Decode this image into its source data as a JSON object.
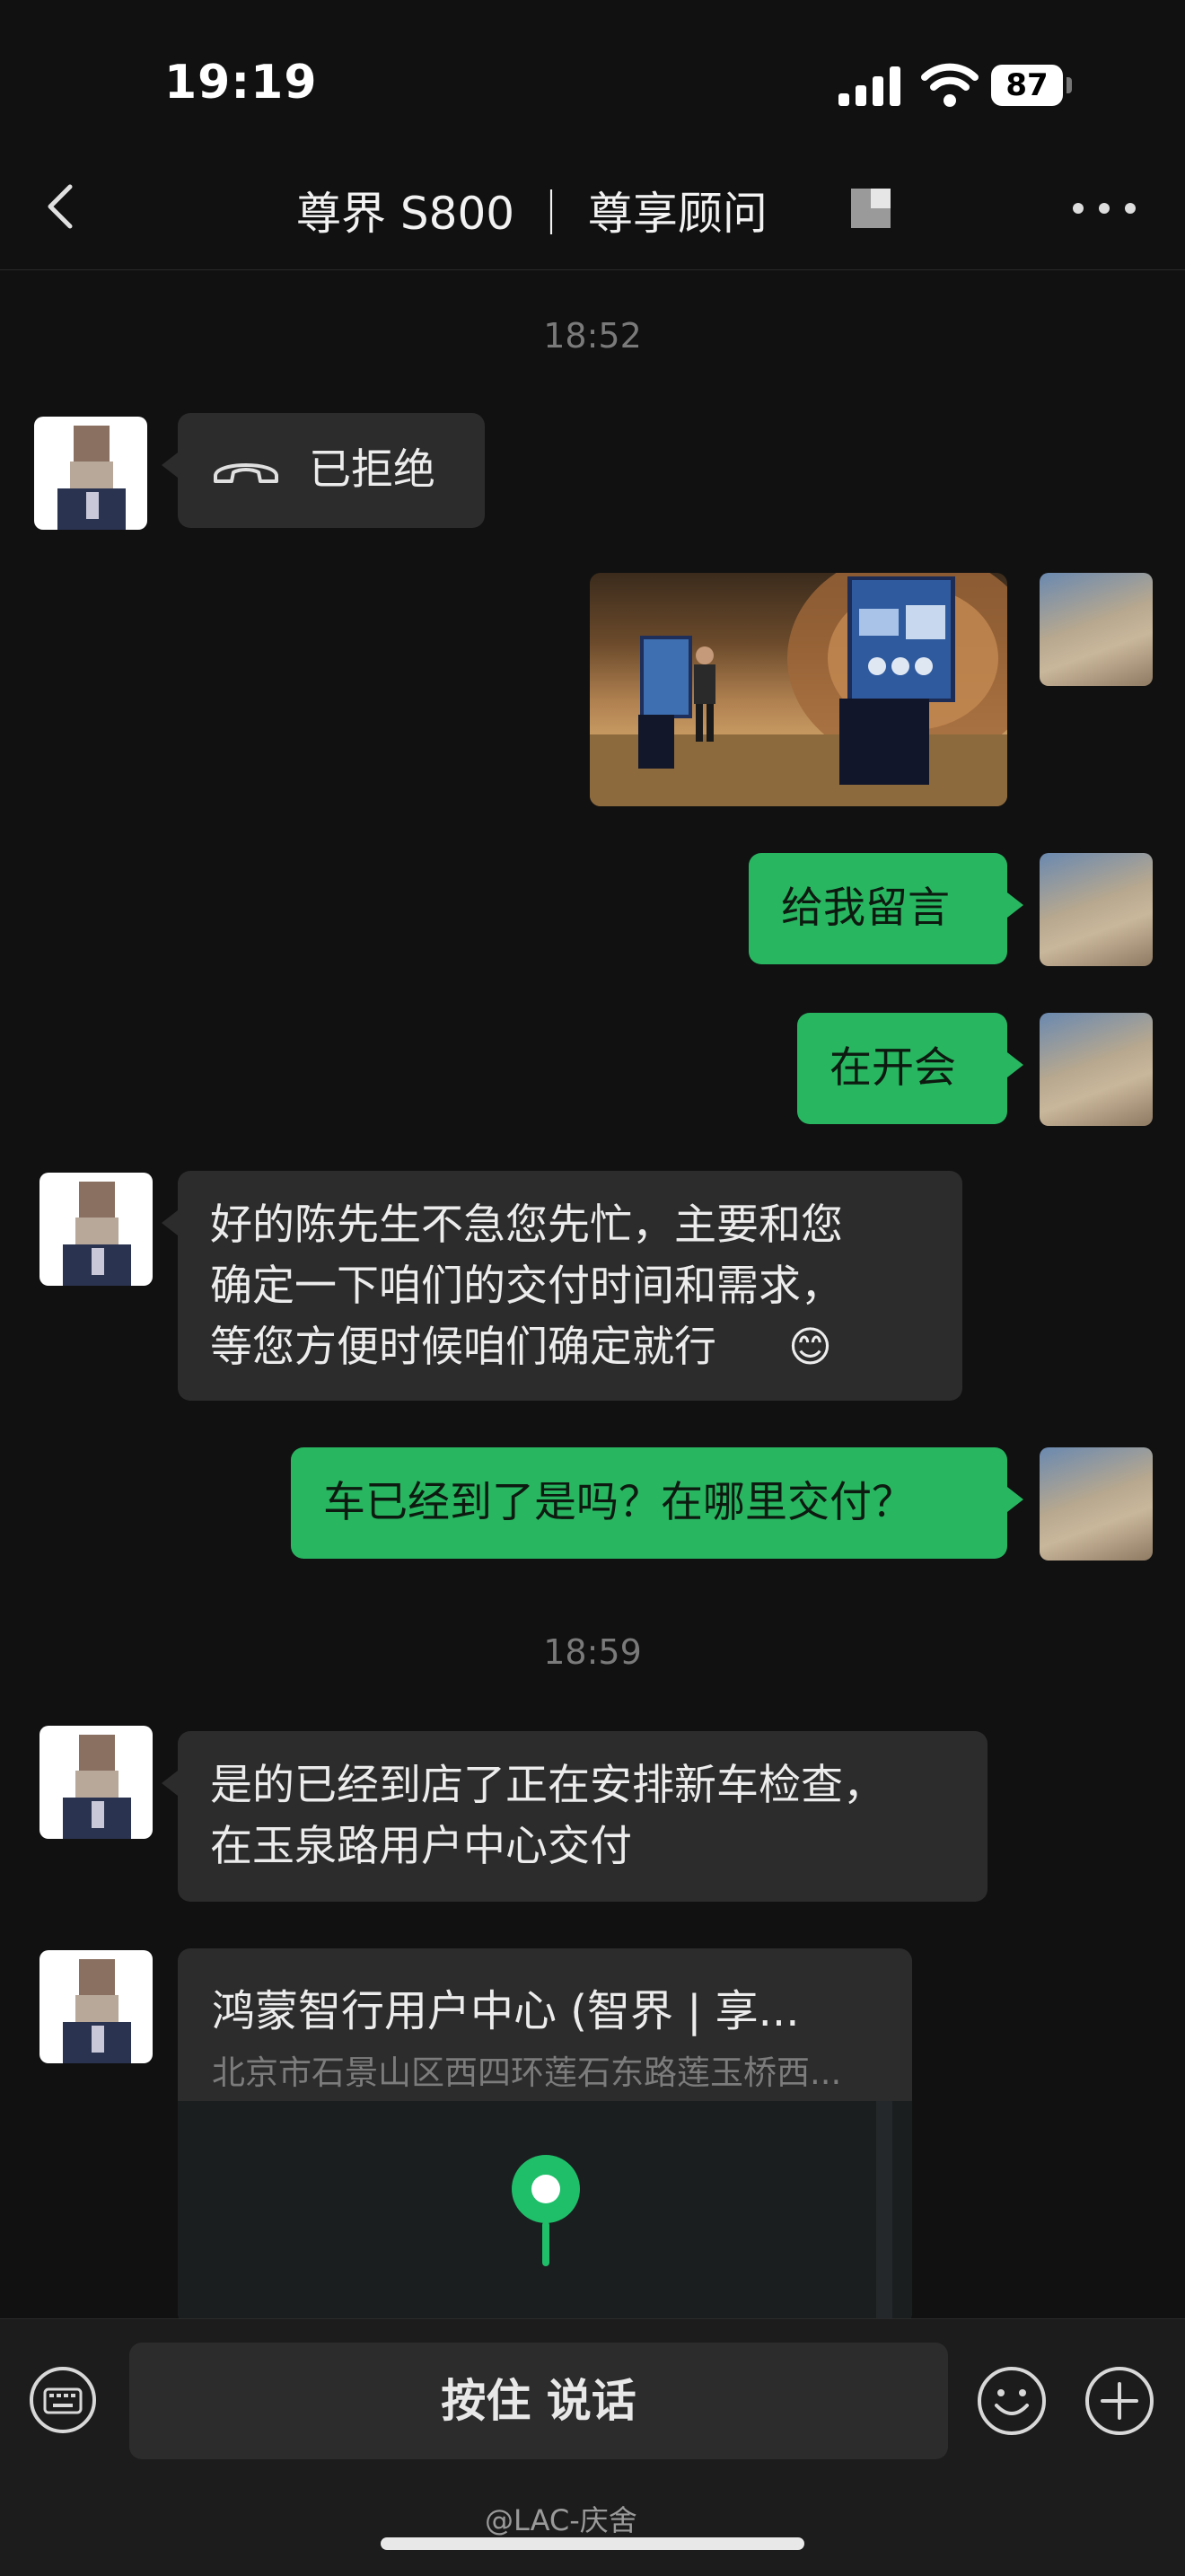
{
  "status_bar": {
    "time": "19:19",
    "battery": "87"
  },
  "nav": {
    "title": "尊界 S800 ｜ 尊享顾问",
    "back_icon": "chevron-left-icon",
    "more_icon": "more-dots-icon"
  },
  "messages": [
    {
      "type": "timestamp",
      "text": "18:52"
    },
    {
      "type": "call",
      "side": "in",
      "text": "已拒绝",
      "icon": "phone-hangup-icon"
    },
    {
      "type": "image",
      "side": "out",
      "description": "presentation-photo"
    },
    {
      "type": "text",
      "side": "out",
      "text": "给我留言"
    },
    {
      "type": "text",
      "side": "out",
      "text": "在开会"
    },
    {
      "type": "text",
      "side": "in",
      "lines": [
        "好的陈先生不急您先忙，主要和您",
        "确定一下咱们的交付时间和需求，",
        "等您方便时候咱们确定就行"
      ],
      "emoji": "😊"
    },
    {
      "type": "text",
      "side": "out",
      "text": "车已经到了是吗？在哪里交付？"
    },
    {
      "type": "timestamp",
      "text": "18:59"
    },
    {
      "type": "text",
      "side": "in",
      "lines": [
        "是的已经到店了正在安排新车检查，",
        "在玉泉路用户中心交付"
      ]
    },
    {
      "type": "location",
      "side": "in",
      "title": "鸿蒙智行用户中心 (智界 | 享...",
      "address": "北京市石景山区西四环莲石东路莲玉桥西..."
    }
  ],
  "input_bar": {
    "hold_to_talk": "按住 说话",
    "keyboard_icon": "keyboard-icon",
    "emoji_icon": "emoji-icon",
    "plus_icon": "plus-icon"
  },
  "watermark": "@LAC-庆舍",
  "colors": {
    "background": "#111111",
    "bubble_in": "#2c2c2c",
    "bubble_out": "#28b661",
    "pin": "#1fbf6a"
  }
}
